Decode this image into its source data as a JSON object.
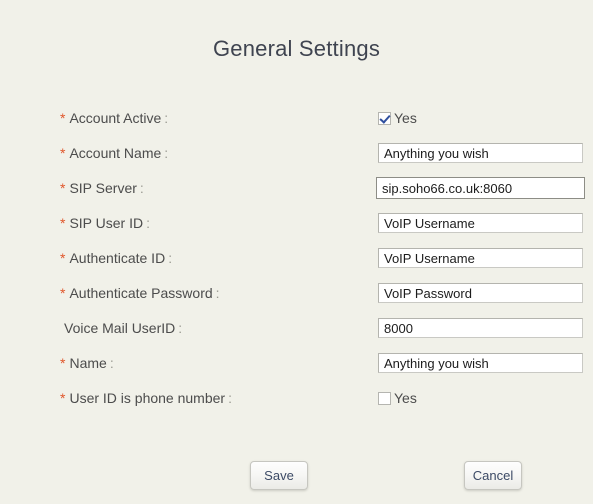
{
  "page": {
    "title": "General Settings"
  },
  "form": {
    "rows": [
      {
        "required": "*",
        "label": "Account Active",
        "colon": ":",
        "control": "checkbox",
        "checked": true,
        "checkbox_label": "Yes",
        "name": "account-active"
      },
      {
        "required": "*",
        "label": "Account Name",
        "colon": ":",
        "control": "text",
        "value": "Anything you wish",
        "focused": false,
        "name": "account-name"
      },
      {
        "required": "*",
        "label": "SIP Server",
        "colon": ":",
        "control": "text",
        "value": "sip.soho66.co.uk:8060",
        "focused": true,
        "name": "sip-server"
      },
      {
        "required": "*",
        "label": "SIP User ID",
        "colon": ":",
        "control": "text",
        "value": "VoIP Username",
        "focused": false,
        "name": "sip-user-id"
      },
      {
        "required": "*",
        "label": "Authenticate ID",
        "colon": ":",
        "control": "text",
        "value": "VoIP Username",
        "focused": false,
        "name": "authenticate-id"
      },
      {
        "required": "*",
        "label": "Authenticate Password",
        "colon": ":",
        "control": "text",
        "value": "VoIP Password",
        "focused": false,
        "name": "authenticate-password"
      },
      {
        "required": "",
        "label": "Voice Mail UserID",
        "colon": ":",
        "control": "text",
        "value": "8000",
        "focused": false,
        "name": "voice-mail-userid"
      },
      {
        "required": "*",
        "label": "Name",
        "colon": ":",
        "control": "text",
        "value": "Anything you wish",
        "focused": false,
        "name": "name"
      },
      {
        "required": "*",
        "label": "User ID is phone number",
        "colon": ":",
        "control": "checkbox",
        "checked": false,
        "checkbox_label": "Yes",
        "name": "user-id-is-phone-number"
      }
    ]
  },
  "buttons": {
    "save_label": "Save",
    "cancel_label": "Cancel"
  },
  "colors": {
    "background": "#f1f1e9",
    "title": "#3f4450",
    "label": "#4c4c4c",
    "required_star": "#e0562a",
    "field_border": "#c9c9c4",
    "field_border_focused": "#8d8d86",
    "button_text": "#3c4a66",
    "checkmark": "#2f4f9e"
  }
}
